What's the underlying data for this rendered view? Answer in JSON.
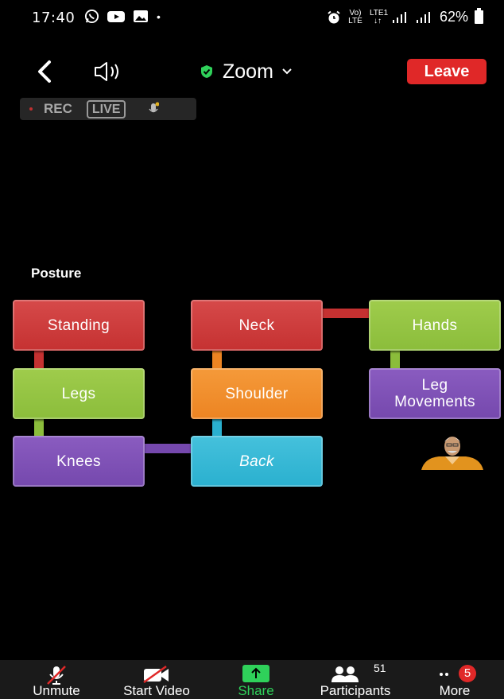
{
  "status_bar": {
    "time": "17:40",
    "lte_badge": "Vo) LTE",
    "lte2_badge": "LTE1 ↓↑",
    "battery": "62%"
  },
  "meeting": {
    "title": "Zoom",
    "leave_label": "Leave",
    "rec_label": "REC",
    "live_label": "LIVE"
  },
  "content": {
    "title": "Posture",
    "boxes": {
      "standing": "Standing",
      "legs": "Legs",
      "knees": "Knees",
      "neck": "Neck",
      "shoulder": "Shoulder",
      "back": "Back",
      "hands": "Hands",
      "leg_movements_1": "Leg",
      "leg_movements_2": "Movements"
    }
  },
  "toolbar": {
    "unmute": "Unmute",
    "start_video": "Start Video",
    "share": "Share",
    "participants": "Participants",
    "participants_count": "51",
    "more": "More",
    "more_badge": "5"
  },
  "colors": {
    "leave": "#e02828",
    "share": "#2fd15a",
    "shield": "#2fd15a"
  }
}
